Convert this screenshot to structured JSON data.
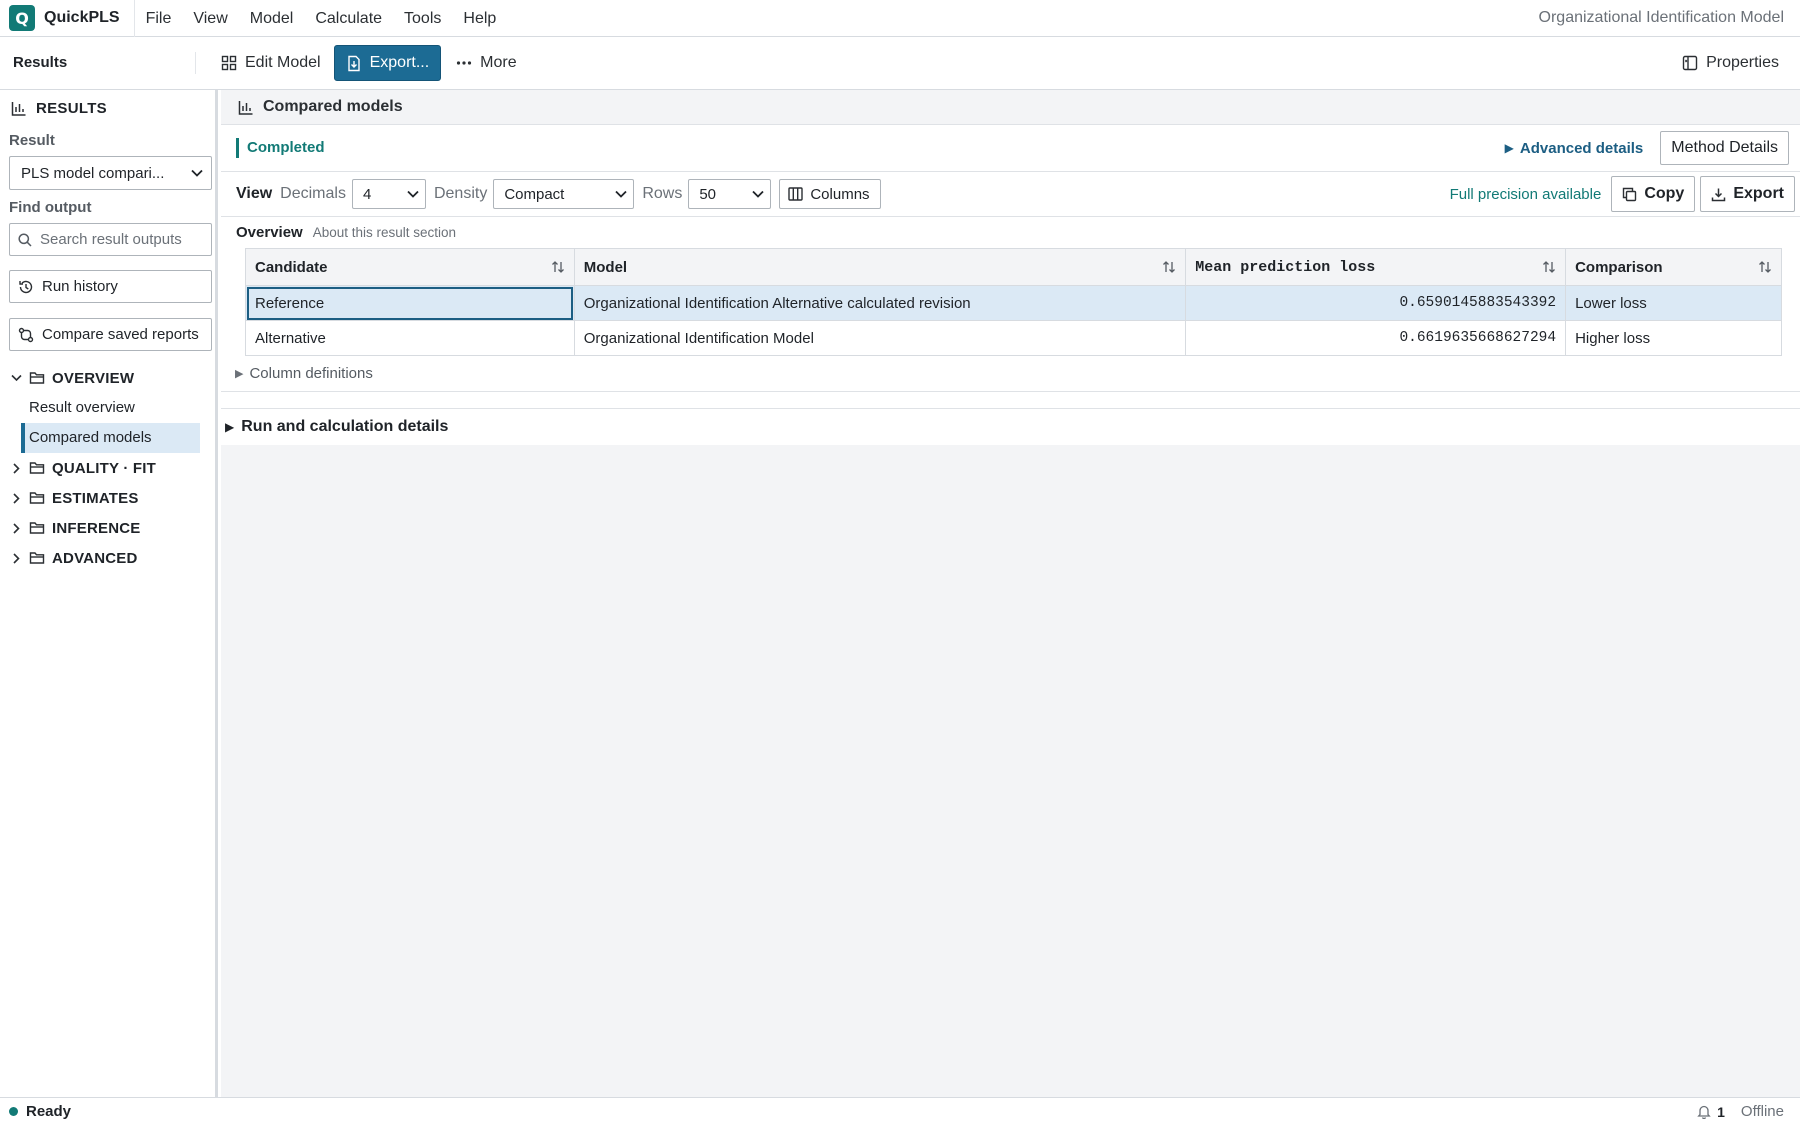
{
  "app": {
    "logo_letter": "Q",
    "name": "QuickPLS",
    "document_title": "Organizational Identification Model"
  },
  "menu": [
    "File",
    "View",
    "Model",
    "Calculate",
    "Tools",
    "Help"
  ],
  "toolbar": {
    "section": "Results",
    "edit_model": "Edit Model",
    "export": "Export...",
    "more": "More",
    "properties": "Properties"
  },
  "sidebar": {
    "title": "RESULTS",
    "result_label": "Result",
    "result_value": "PLS model compari...",
    "find_label": "Find output",
    "search_placeholder": "Search result outputs",
    "run_history": "Run history",
    "compare_reports": "Compare saved reports",
    "groups": {
      "overview": "OVERVIEW",
      "quality": "QUALITY · FIT",
      "estimates": "ESTIMATES",
      "inference": "INFERENCE",
      "advanced": "ADVANCED"
    },
    "overview_items": [
      "Result overview",
      "Compared models"
    ]
  },
  "main": {
    "title": "Compared models",
    "status": "Completed",
    "advanced_details": "Advanced details",
    "method_details": "Method Details",
    "view_label": "View",
    "decimals_label": "Decimals",
    "decimals_value": "4",
    "density_label": "Density",
    "density_value": "Compact",
    "rows_label": "Rows",
    "rows_value": "50",
    "columns_button": "Columns",
    "full_precision": "Full precision available",
    "copy": "Copy",
    "export": "Export",
    "overview_title": "Overview",
    "overview_about": "About this result section",
    "table": {
      "headers": [
        "Candidate",
        "Model",
        "Mean prediction loss",
        "Comparison"
      ],
      "rows": [
        [
          "Reference",
          "Organizational Identification Alternative calculated revision",
          "0.6590145883543392",
          "Lower loss"
        ],
        [
          "Alternative",
          "Organizational Identification Model",
          "0.6619635668627294",
          "Higher loss"
        ]
      ]
    },
    "column_definitions": "Column definitions",
    "run_details": "Run and calculation details"
  },
  "statusbar": {
    "ready": "Ready",
    "notifications": "1",
    "connection": "Offline"
  },
  "colors": {
    "accent": "#127a76",
    "primary_button": "#1c6b94",
    "selection": "#dbe9f5"
  }
}
